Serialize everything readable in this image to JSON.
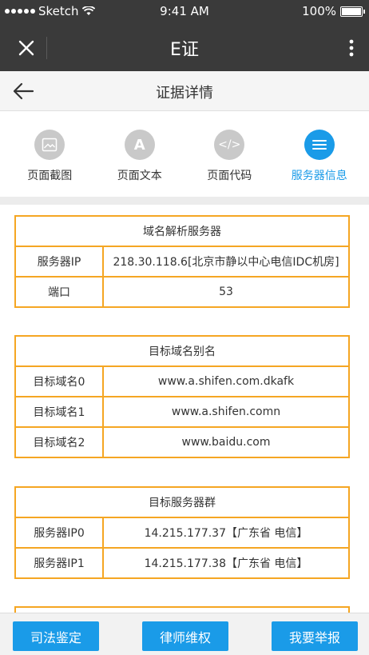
{
  "status_bar": {
    "carrier": "Sketch",
    "time": "9:41 AM",
    "battery": "100%"
  },
  "app_bar": {
    "title": "E证"
  },
  "nav": {
    "title": "证据详情"
  },
  "tabs": [
    {
      "label": "页面截图",
      "icon": "image-icon",
      "active": false
    },
    {
      "label": "页面文本",
      "icon": "text-icon",
      "glyph": "A",
      "active": false
    },
    {
      "label": "页面代码",
      "icon": "code-icon",
      "glyph": "</>",
      "active": false
    },
    {
      "label": "服务器信息",
      "icon": "list-icon",
      "active": true
    }
  ],
  "sections": [
    {
      "title": "域名解析服务器",
      "rows": [
        {
          "key": "服务器IP",
          "value": "218.30.118.6[北京市静以中心电信IDC机房]"
        },
        {
          "key": "端口",
          "value": "53"
        }
      ]
    },
    {
      "title": "目标域名别名",
      "rows": [
        {
          "key": "目标域名0",
          "value": "www.a.shifen.com.dkafk"
        },
        {
          "key": "目标域名1",
          "value": "www.a.shifen.comn"
        },
        {
          "key": "目标域名2",
          "value": "www.baidu.com"
        }
      ]
    },
    {
      "title": "目标服务器群",
      "rows": [
        {
          "key": "服务器IP0",
          "value": "14.215.177.37【广东省 电信】"
        },
        {
          "key": "服务器IP1",
          "value": "14.215.177.38【广东省 电信】"
        }
      ]
    }
  ],
  "bottom_buttons": [
    {
      "label": "司法鉴定"
    },
    {
      "label": "律师维权"
    },
    {
      "label": "我要举报"
    }
  ],
  "colors": {
    "accent": "#1a9be8",
    "border": "#f5a623",
    "dark_bar": "#3a3a3a"
  }
}
